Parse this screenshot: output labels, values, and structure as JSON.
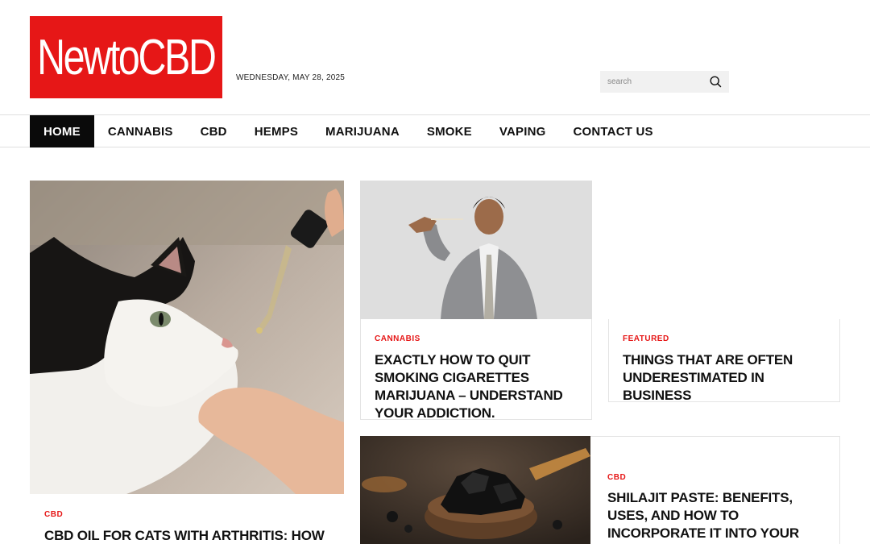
{
  "header": {
    "logo_text": "NewtoCBD",
    "date": "WEDNESDAY, MAY 28, 2025",
    "search_placeholder": "search",
    "search_icon": "magnifier-icon"
  },
  "nav": {
    "items": [
      {
        "label": "HOME",
        "active": true
      },
      {
        "label": "CANNABIS"
      },
      {
        "label": "CBD"
      },
      {
        "label": "HEMPS"
      },
      {
        "label": "MARIJUANA"
      },
      {
        "label": "SMOKE"
      },
      {
        "label": "VAPING"
      },
      {
        "label": "CONTACT US"
      }
    ]
  },
  "articles": {
    "big": {
      "category": "CBD",
      "title": "CBD OIL FOR CATS WITH ARTHRITIS: HOW IT CAN"
    },
    "mid": {
      "category": "CANNABIS",
      "title": "EXACTLY HOW TO QUIT SMOKING CIGARETTES MARIJUANA – UNDERSTAND YOUR ADDICTION."
    },
    "featured": {
      "category": "FEATURED",
      "title": "THINGS THAT ARE OFTEN UNDERESTIMATED IN BUSINESS"
    },
    "bottom": {
      "category": "CBD",
      "title": "SHILAJIT PASTE: BENEFITS, USES, AND HOW TO INCORPORATE IT INTO YOUR ROUTINE"
    }
  },
  "colors": {
    "brand_red": "#e61717",
    "nav_active_bg": "#0a0a0a"
  }
}
